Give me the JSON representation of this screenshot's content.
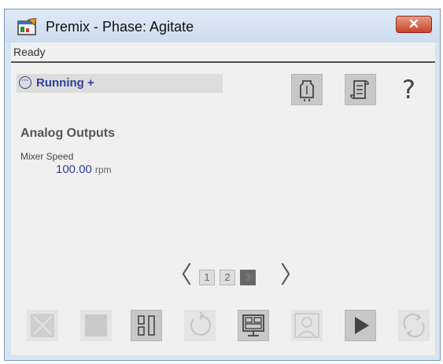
{
  "window": {
    "title": "Premix - Phase: Agitate",
    "close_symbol": "✕",
    "app_icon": "faceplate-app-icon"
  },
  "status": {
    "text": "Ready"
  },
  "state": {
    "icon": "more-circle-icon",
    "icon_glyph": "···",
    "label": "Running +"
  },
  "header_buttons": [
    {
      "name": "vessel-button",
      "icon": "vessel-icon"
    },
    {
      "name": "procedure-button",
      "icon": "scroll-icon"
    }
  ],
  "help": {
    "label": "?"
  },
  "analog_outputs": {
    "title": "Analog Outputs",
    "items": [
      {
        "label": "Mixer Speed",
        "value": "100.00",
        "unit": "rpm"
      }
    ]
  },
  "pager": {
    "prev": "〈",
    "next": "〉",
    "pages": [
      "1",
      "2",
      "3"
    ],
    "current": "3"
  },
  "bottom_buttons": [
    {
      "name": "abort-button",
      "icon": "abort-icon",
      "enabled": false
    },
    {
      "name": "stop-button",
      "icon": "stop-icon",
      "enabled": false
    },
    {
      "name": "hold-button",
      "icon": "hold-icon",
      "enabled": true
    },
    {
      "name": "restart-button",
      "icon": "restart-icon",
      "enabled": false
    },
    {
      "name": "operator-display-button",
      "icon": "monitor-icon",
      "enabled": true
    },
    {
      "name": "operator-button",
      "icon": "person-icon",
      "enabled": false
    },
    {
      "name": "start-button",
      "icon": "play-icon",
      "enabled": true
    },
    {
      "name": "reset-button",
      "icon": "reset-icon",
      "enabled": false
    }
  ],
  "colors": {
    "accent": "#3140a2",
    "value": "#2e3e9a",
    "close": "#c7432a"
  }
}
